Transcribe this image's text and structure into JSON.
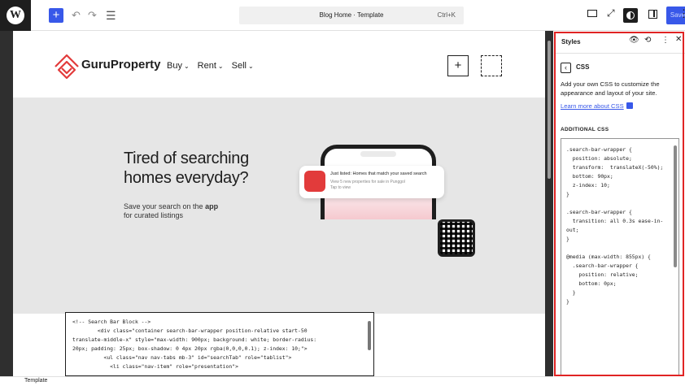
{
  "toolbar": {
    "add_icon": "plus-icon",
    "undo_icon": "undo-icon",
    "redo_icon": "redo-icon",
    "outline_icon": "list-view-icon",
    "document_title": "Blog Home · Template",
    "shortcut": "Ctrl+K",
    "save_label": "Save",
    "colors": {
      "accent": "#3858e9",
      "dark": "#1e1e1e"
    }
  },
  "site": {
    "logo_text": "GuruProperty",
    "nav": [
      {
        "label": "Buy"
      },
      {
        "label": "Rent"
      },
      {
        "label": "Sell"
      }
    ],
    "hero": {
      "heading_line1": "Tired of searching",
      "heading_line2": "homes everyday?",
      "sub_prefix": "Save your search on the ",
      "sub_bold": "app",
      "sub_line2": "for curated listings",
      "notification_title": "Just listed: Homes that match your saved search",
      "notification_body": "View 5 new properties for sale in Punggol",
      "notification_tap": "Tap to view"
    },
    "code_block": {
      "text": "<!-- Search Bar Block -->\n        <div class=\"container search-bar-wrapper position-relative start-50\ntranslate-middle-x\" style=\"max-width: 900px; background: white; border-radius:\n20px; padding: 25px; box-shadow: 0 4px 20px rgba(0,0,0,0.1); z-index: 10;\">\n          <ul class=\"nav nav-tabs mb-3\" id=\"searchTab\" role=\"tablist\">\n            <li class=\"nav-item\" role=\"presentation\">"
    }
  },
  "footer": {
    "label": "Template"
  },
  "sidebar": {
    "title": "Styles",
    "section": "CSS",
    "description": "Add your own CSS to customize the appearance and layout of your site.",
    "learn_more": "Learn more about CSS",
    "additional_label": "ADDITIONAL CSS",
    "css": ".search-bar-wrapper {\n  position: absolute;\n  transform:  translateX(-50%);\n  bottom: 90px;\n  z-index: 10;\n}\n\n.search-bar-wrapper {\n  transition: all 0.3s ease-in-\nout;\n}\n\n@media (max-width: 855px) {\n  .search-bar-wrapper {\n    position: relative;\n    bottom: 0px;\n  }\n}",
    "highlight_color": "#e02424"
  }
}
